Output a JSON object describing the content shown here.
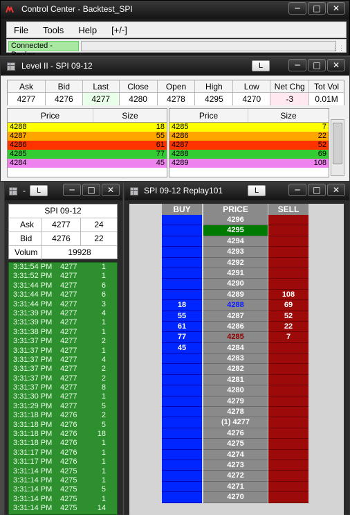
{
  "control_center": {
    "title": "Control Center - Backtest_SPI",
    "menu": [
      "File",
      "Tools",
      "Help",
      "[+/-]"
    ],
    "status": "Connected - Replay"
  },
  "level2": {
    "title": "Level II - SPI 09-12",
    "lock_label": "L",
    "columns": [
      "Ask",
      "Bid",
      "Last",
      "Close",
      "Open",
      "High",
      "Low",
      "Net Chg",
      "Tot Vol"
    ],
    "values": [
      "4277",
      "4276",
      "4277",
      "4280",
      "4278",
      "4295",
      "4270",
      "-3",
      "0.01M"
    ],
    "book_headers": {
      "price": "Price",
      "size": "Size"
    },
    "bids": [
      {
        "price": "4288",
        "size": "18",
        "color": "#ffff00"
      },
      {
        "price": "4287",
        "size": "55",
        "color": "#ffa500"
      },
      {
        "price": "4286",
        "size": "61",
        "color": "#ff3300"
      },
      {
        "price": "4285",
        "size": "77",
        "color": "#33cc33"
      },
      {
        "price": "4284",
        "size": "45",
        "color": "#ee82ee"
      }
    ],
    "asks": [
      {
        "price": "4285",
        "size": "7",
        "color": "#ffff00"
      },
      {
        "price": "4286",
        "size": "22",
        "color": "#ffa500"
      },
      {
        "price": "4287",
        "size": "52",
        "color": "#ff3300"
      },
      {
        "price": "4288",
        "size": "69",
        "color": "#33cc33"
      },
      {
        "price": "4289",
        "size": "108",
        "color": "#ee82ee"
      }
    ]
  },
  "tns": {
    "title": "-",
    "lock_label": "L",
    "symbol": "SPI 09-12",
    "ask_label": "Ask",
    "ask_price": "4277",
    "ask_size": "24",
    "bid_label": "Bid",
    "bid_price": "4276",
    "bid_size": "22",
    "volume_label": "Volum",
    "volume": "19928",
    "trades": [
      [
        "3:31:54 PM",
        "4277",
        "1"
      ],
      [
        "3:31:52 PM",
        "4277",
        "1"
      ],
      [
        "3:31:44 PM",
        "4277",
        "6"
      ],
      [
        "3:31:44 PM",
        "4277",
        "6"
      ],
      [
        "3:31:44 PM",
        "4277",
        "3"
      ],
      [
        "3:31:39 PM",
        "4277",
        "4"
      ],
      [
        "3:31:39 PM",
        "4277",
        "1"
      ],
      [
        "3:31:38 PM",
        "4277",
        "1"
      ],
      [
        "3:31:37 PM",
        "4277",
        "2"
      ],
      [
        "3:31:37 PM",
        "4277",
        "1"
      ],
      [
        "3:31:37 PM",
        "4277",
        "4"
      ],
      [
        "3:31:37 PM",
        "4277",
        "2"
      ],
      [
        "3:31:37 PM",
        "4277",
        "2"
      ],
      [
        "3:31:37 PM",
        "4277",
        "8"
      ],
      [
        "3:31:30 PM",
        "4277",
        "1"
      ],
      [
        "3:31:29 PM",
        "4277",
        "5"
      ],
      [
        "3:31:18 PM",
        "4276",
        "2"
      ],
      [
        "3:31:18 PM",
        "4276",
        "5"
      ],
      [
        "3:31:18 PM",
        "4276",
        "18"
      ],
      [
        "3:31:18 PM",
        "4276",
        "1"
      ],
      [
        "3:31:17 PM",
        "4276",
        "1"
      ],
      [
        "3:31:17 PM",
        "4276",
        "1"
      ],
      [
        "3:31:14 PM",
        "4275",
        "1"
      ],
      [
        "3:31:14 PM",
        "4275",
        "1"
      ],
      [
        "3:31:14 PM",
        "4275",
        "5"
      ],
      [
        "3:31:14 PM",
        "4275",
        "1"
      ],
      [
        "3:31:14 PM",
        "4275",
        "14"
      ]
    ]
  },
  "ladder": {
    "title": "SPI 09-12 Replay101",
    "lock_label": "L",
    "headers": {
      "buy": "BUY",
      "price": "PRICE",
      "sell": "SELL"
    },
    "colors": {
      "buy": "#0026ff",
      "price": "#8a8a8a",
      "sell": "#9c0a0a",
      "last_trade": "#007a00",
      "bid_price": "#0a1cff",
      "ask_price": "#8b0000"
    },
    "rows": [
      {
        "buy": "",
        "price": "4296",
        "sell": ""
      },
      {
        "buy": "",
        "price": "4295",
        "sell": "",
        "highlight": true
      },
      {
        "buy": "",
        "price": "4294",
        "sell": ""
      },
      {
        "buy": "",
        "price": "4293",
        "sell": ""
      },
      {
        "buy": "",
        "price": "4292",
        "sell": ""
      },
      {
        "buy": "",
        "price": "4291",
        "sell": ""
      },
      {
        "buy": "",
        "price": "4290",
        "sell": ""
      },
      {
        "buy": "",
        "price": "4289",
        "sell": "108"
      },
      {
        "buy": "18",
        "price": "4288",
        "sell": "69",
        "price_color": "bid"
      },
      {
        "buy": "55",
        "price": "4287",
        "sell": "52"
      },
      {
        "buy": "61",
        "price": "4286",
        "sell": "22"
      },
      {
        "buy": "77",
        "price": "4285",
        "sell": "7",
        "price_color": "ask"
      },
      {
        "buy": "45",
        "price": "4284",
        "sell": ""
      },
      {
        "buy": "",
        "price": "4283",
        "sell": ""
      },
      {
        "buy": "",
        "price": "4282",
        "sell": ""
      },
      {
        "buy": "",
        "price": "4281",
        "sell": ""
      },
      {
        "buy": "",
        "price": "4280",
        "sell": ""
      },
      {
        "buy": "",
        "price": "4279",
        "sell": ""
      },
      {
        "buy": "",
        "price": "4278",
        "sell": ""
      },
      {
        "buy": "",
        "price": "(1) 4277",
        "sell": ""
      },
      {
        "buy": "",
        "price": "4276",
        "sell": ""
      },
      {
        "buy": "",
        "price": "4275",
        "sell": ""
      },
      {
        "buy": "",
        "price": "4274",
        "sell": ""
      },
      {
        "buy": "",
        "price": "4273",
        "sell": ""
      },
      {
        "buy": "",
        "price": "4272",
        "sell": ""
      },
      {
        "buy": "",
        "price": "4271",
        "sell": ""
      },
      {
        "buy": "",
        "price": "4270",
        "sell": ""
      }
    ]
  }
}
